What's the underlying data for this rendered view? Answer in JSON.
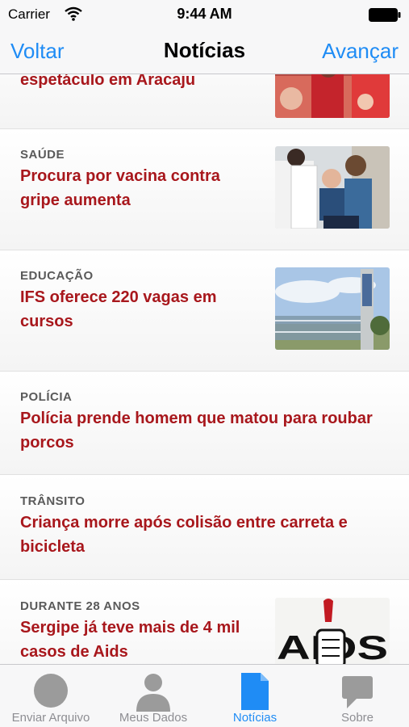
{
  "status_bar": {
    "carrier": "Carrier",
    "time": "9:44 AM"
  },
  "nav": {
    "back": "Voltar",
    "title": "Notícias",
    "forward": "Avançar",
    "accent_color": "#1f8cf5"
  },
  "news": [
    {
      "category": "",
      "title": "espetáculo em Aracaju",
      "has_image": true,
      "image_icon": "crowd-photo"
    },
    {
      "category": "SAÚDE",
      "title": "Procura por vacina contra gripe aumenta",
      "has_image": true,
      "image_icon": "vaccination-photo"
    },
    {
      "category": "EDUCAÇÃO",
      "title": "IFS oferece 220 vagas em cursos",
      "has_image": true,
      "image_icon": "campus-gate-photo"
    },
    {
      "category": "POLÍCIA",
      "title": "Polícia prende homem que matou para roubar porcos",
      "has_image": false
    },
    {
      "category": "TRÂNSITO",
      "title": "Criança morre após colisão entre carreta e bicicleta",
      "has_image": false
    },
    {
      "category": "DURANTE 28 ANOS",
      "title": "Sergipe já teve mais de 4 mil casos de Aids",
      "has_image": true,
      "image_icon": "aids-campaign-photo",
      "image_text": "AIDS"
    }
  ],
  "title_color": "#a8171c",
  "tabs": [
    {
      "label": "Enviar Arquivo",
      "icon": "circle-icon",
      "active": false
    },
    {
      "label": "Meus Dados",
      "icon": "person-icon",
      "active": false
    },
    {
      "label": "Notícias",
      "icon": "document-icon",
      "active": true
    },
    {
      "label": "Sobre",
      "icon": "speech-bubble-icon",
      "active": false
    }
  ]
}
